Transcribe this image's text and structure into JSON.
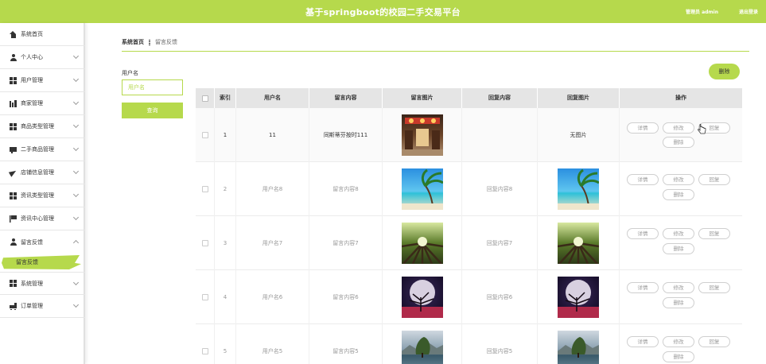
{
  "header": {
    "title": "基于springboot的校园二手交易平台",
    "user": "管理员 admin",
    "logout": "退出登录",
    "accent_color": "#b6d94c"
  },
  "sidebar": {
    "items": [
      {
        "label": "系统首页",
        "icon": "home-icon"
      },
      {
        "label": "个人中心",
        "icon": "user-icon"
      },
      {
        "label": "用户管理",
        "icon": "grid-icon"
      },
      {
        "label": "商家管理",
        "icon": "bar-chart-icon"
      },
      {
        "label": "商品类型管理",
        "icon": "grid-icon"
      },
      {
        "label": "二手商品管理",
        "icon": "card-icon"
      },
      {
        "label": "店铺信息管理",
        "icon": "paper-plane-icon"
      },
      {
        "label": "资讯类型管理",
        "icon": "grid-icon"
      },
      {
        "label": "资讯中心管理",
        "icon": "flag-icon"
      },
      {
        "label": "留言反馈",
        "icon": "user-icon"
      },
      {
        "label": "系统管理",
        "icon": "grid-icon"
      },
      {
        "label": "订单管理",
        "icon": "cart-icon"
      }
    ],
    "active_sub": "留言反馈"
  },
  "breadcrumb": {
    "home": "系统首页",
    "current": "留言反馈"
  },
  "search": {
    "label": "用户名",
    "placeholder": "用户名",
    "button": "查询"
  },
  "toolbar": {
    "delete": "删除"
  },
  "table": {
    "headers": [
      "索引",
      "用户名",
      "留言内容",
      "留言图片",
      "回复内容",
      "回复图片",
      "操作"
    ],
    "actions": {
      "detail": "详情",
      "edit": "修改",
      "reply": "回复",
      "delete": "删除"
    },
    "rows": [
      {
        "index": "1",
        "username": "11",
        "content": "同斯蒂芬按时111",
        "image": "shop-interior-photo",
        "reply": "",
        "reply_image_text": "无图片"
      },
      {
        "index": "2",
        "username": "用户名8",
        "content": "留言内容8",
        "image": "beach-photo",
        "reply": "回复内容8",
        "reply_image": "beach-photo"
      },
      {
        "index": "3",
        "username": "用户名7",
        "content": "留言内容7",
        "image": "forest-photo",
        "reply": "回复内容7",
        "reply_image": "forest-photo"
      },
      {
        "index": "4",
        "username": "用户名6",
        "content": "留言内容6",
        "image": "moon-tree-photo",
        "reply": "回复内容6",
        "reply_image": "moon-tree-photo"
      },
      {
        "index": "5",
        "username": "用户名5",
        "content": "留言内容5",
        "image": "lake-tree-photo",
        "reply": "回复内容5",
        "reply_image": "lake-tree-photo"
      }
    ]
  }
}
